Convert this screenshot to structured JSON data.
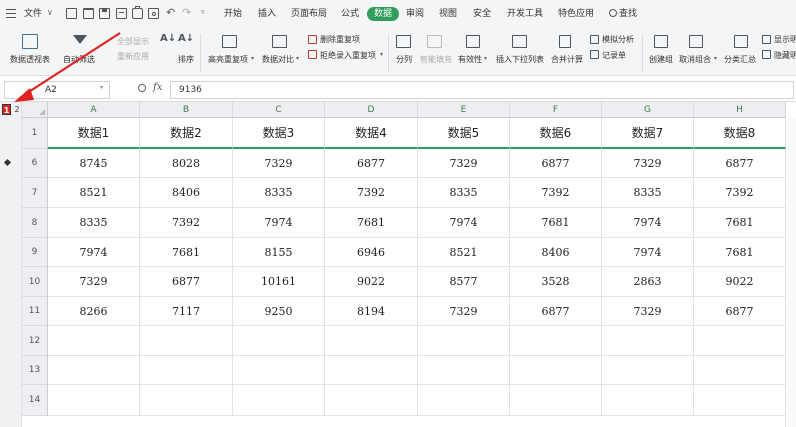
{
  "menubar": {
    "file_label": "文件",
    "tabs": [
      "开始",
      "插入",
      "页面布局",
      "公式",
      "数据",
      "审阅",
      "视图",
      "安全",
      "开发工具",
      "特色应用"
    ],
    "active_tab": "数据",
    "search_label": "查找"
  },
  "ribbon": {
    "pivot": "数据透视表",
    "autofilter": "自动筛选",
    "show_all": "全部显示",
    "reapply": "重新应用",
    "sort": "排序",
    "highlight_dup": "高亮重复项",
    "compare": "数据对比",
    "remove_dup": "删除重复项",
    "reject_dup": "拒绝录入重复项",
    "split": "分列",
    "smart_fill": "智能填充",
    "validation": "有效性",
    "insert_dropdown": "插入下拉列表",
    "consolidate": "合并计算",
    "simulate": "模拟分析",
    "record": "记录单",
    "group": "创建组",
    "ungroup": "取消组合",
    "subtotal": "分类汇总",
    "show_detail": "显示明",
    "hide_detail": "隐藏明"
  },
  "formula": {
    "cell_ref": "A2",
    "fx": "fx",
    "value": "9136"
  },
  "outline": {
    "level1": "1",
    "level2": "2"
  },
  "sheet": {
    "columns": [
      "A",
      "B",
      "C",
      "D",
      "E",
      "F",
      "G",
      "H"
    ],
    "rows": [
      {
        "num": "1",
        "cells": [
          "数据1",
          "数据2",
          "数据3",
          "数据4",
          "数据5",
          "数据6",
          "数据7",
          "数据8"
        ]
      },
      {
        "num": "6",
        "cells": [
          "8745",
          "8028",
          "7329",
          "6877",
          "7329",
          "6877",
          "7329",
          "6877"
        ]
      },
      {
        "num": "7",
        "cells": [
          "8521",
          "8406",
          "8335",
          "7392",
          "8335",
          "7392",
          "8335",
          "7392"
        ]
      },
      {
        "num": "8",
        "cells": [
          "8335",
          "7392",
          "7974",
          "7681",
          "7974",
          "7681",
          "7974",
          "7681"
        ]
      },
      {
        "num": "9",
        "cells": [
          "7974",
          "7681",
          "8155",
          "6946",
          "8521",
          "8406",
          "7974",
          "7681"
        ]
      },
      {
        "num": "10",
        "cells": [
          "7329",
          "6877",
          "10161",
          "9022",
          "8577",
          "3528",
          "2863",
          "9022"
        ]
      },
      {
        "num": "11",
        "cells": [
          "8266",
          "7117",
          "9250",
          "8194",
          "7329",
          "6877",
          "7329",
          "6877"
        ]
      },
      {
        "num": "12",
        "cells": [
          "",
          "",
          "",
          "",
          "",
          "",
          "",
          ""
        ]
      },
      {
        "num": "13",
        "cells": [
          "",
          "",
          "",
          "",
          "",
          "",
          "",
          ""
        ]
      },
      {
        "num": "14",
        "cells": [
          "",
          "",
          "",
          "",
          "",
          "",
          "",
          ""
        ]
      }
    ]
  },
  "colors": {
    "accent_green": "#2f9d5c",
    "annotation_red": "#e0231f"
  }
}
